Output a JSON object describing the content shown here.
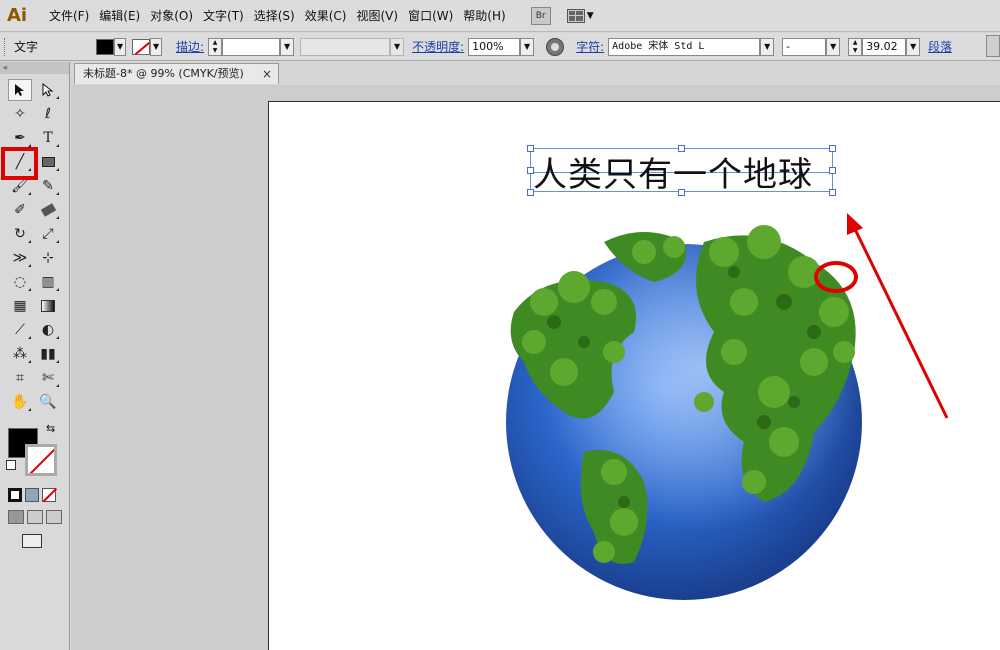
{
  "app": {
    "logo": "Ai"
  },
  "menu": [
    "文件(F)",
    "编辑(E)",
    "对象(O)",
    "文字(T)",
    "选择(S)",
    "效果(C)",
    "视图(V)",
    "窗口(W)",
    "帮助(H)"
  ],
  "bridge_label": "Br",
  "control": {
    "tool_label": "文字",
    "stroke_label": "描边:",
    "opacity_label": "不透明度:",
    "opacity_value": "100%",
    "char_label": "字符:",
    "font_value": "Adobe 宋体 Std L",
    "font_style_value": "-",
    "font_size_value": "39.02",
    "para_label": "段落"
  },
  "document": {
    "tab_title": "未标题-8* @ 99% (CMYK/预览)",
    "close": "×"
  },
  "canvas": {
    "headline": "人类只有一个地球"
  },
  "icons": [
    "selection-arrow-icon",
    "magic-wand-icon",
    "pen-icon",
    "type-icon",
    "line-icon",
    "rectangle-icon",
    "brush-icon",
    "pencil-icon",
    "blob-brush-icon",
    "eraser-icon",
    "rotate-icon",
    "scale-icon",
    "width-icon",
    "free-transform-icon",
    "shape-builder-icon",
    "perspective-icon",
    "mesh-icon",
    "gradient-icon",
    "eyedropper-icon",
    "blend-icon",
    "symbol-sprayer-icon",
    "column-graph-icon",
    "artboard-icon",
    "slice-icon",
    "hand-icon",
    "zoom-icon"
  ],
  "colors": {
    "highlight_red": "#e00000",
    "selection_blue": "#6a8fd8"
  }
}
